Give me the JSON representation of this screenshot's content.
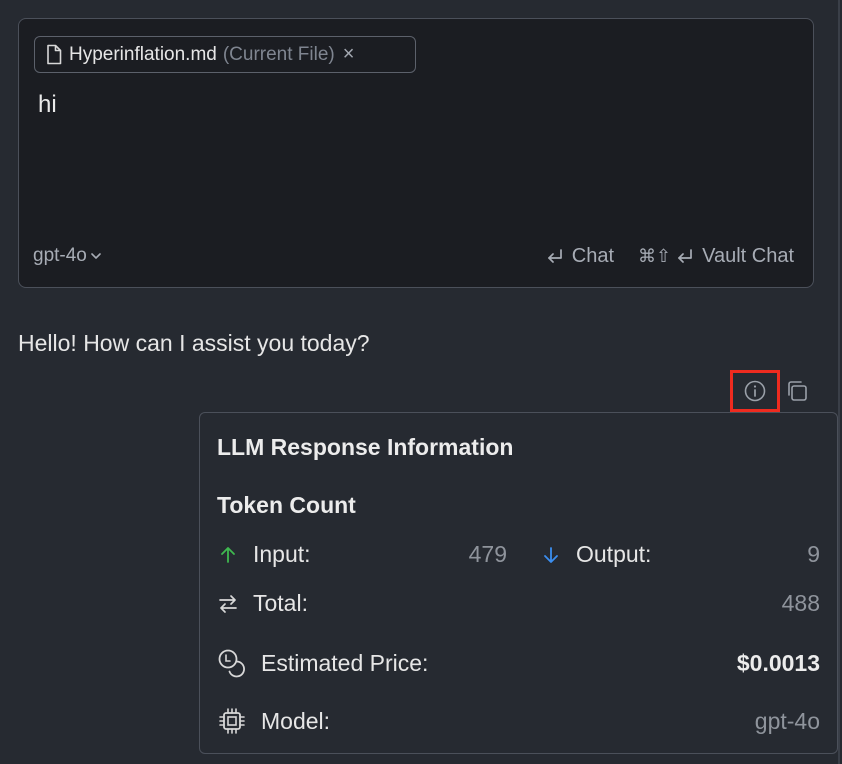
{
  "composer": {
    "file_chip": {
      "name": "Hyperinflation.md",
      "note": "(Current File)",
      "close": "×"
    },
    "input_value": "hi",
    "model": "gpt-4o",
    "chat_hint": "Chat",
    "vault_hint_keys": "⌘⇧",
    "vault_hint": "Vault Chat"
  },
  "message": {
    "text": "Hello! How can I assist you today?"
  },
  "info_popover": {
    "title": "LLM Response Information",
    "section": "Token Count",
    "input_label": "Input:",
    "input_value": "479",
    "output_label": "Output:",
    "output_value": "9",
    "total_label": "Total:",
    "total_value": "488",
    "price_label": "Estimated Price:",
    "price_value": "$0.0013",
    "model_label": "Model:",
    "model_value": "gpt-4o"
  },
  "colors": {
    "background": "#262a31",
    "input_bg": "#1b1d22",
    "highlight": "#ee2b1f",
    "up_arrow": "#3fb950",
    "down_arrow": "#3b8ef0"
  }
}
